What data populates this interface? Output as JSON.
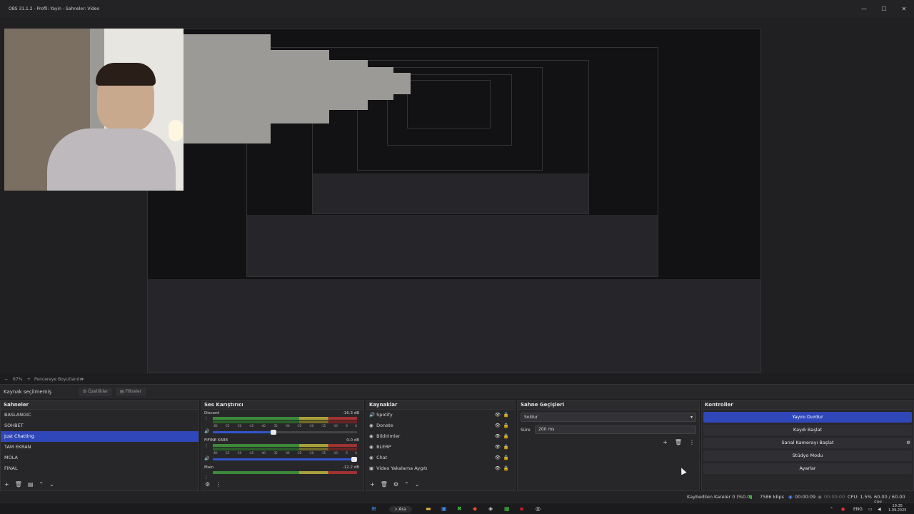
{
  "window": {
    "title": "OBS 31.1.2 - Profil: Yayin - Sahneler: Video",
    "buttons": [
      "—",
      "☐",
      "✕"
    ]
  },
  "preview_strip": {
    "zoom": "67%",
    "fit_label": "Pencereye Boyutlandır"
  },
  "source_bar": {
    "no_source": "Kaynak seçilmemiş",
    "properties": "Özellikler",
    "filters": "Filtreler"
  },
  "scenes": {
    "title": "Sahneler",
    "items": [
      "BASLANGIC",
      "SOHBET",
      "Just Chatting",
      "TAM EKRAN",
      "MOLA",
      "FINAL"
    ],
    "active": "Just Chatting",
    "toolbar": [
      "+",
      "🗑",
      "▤",
      "⌃",
      "⌄"
    ]
  },
  "mixer": {
    "title": "Ses Karıştırıcı",
    "channels": [
      {
        "name": "Discord",
        "db": "-16.3 dB",
        "level": 0.44
      },
      {
        "name": "FIFINE K688",
        "db": "0.0 dB",
        "level": 1.0
      },
      {
        "name": "Main",
        "db": "-12.2 dB",
        "level": 0
      }
    ],
    "ticks": [
      "-60",
      "-55",
      "-50",
      "-45",
      "-40",
      "-35",
      "-30",
      "-25",
      "-20",
      "-15",
      "-10",
      "-5",
      "0"
    ]
  },
  "sources": {
    "title": "Kaynaklar",
    "items": [
      {
        "name": "Spotify",
        "icon": "speaker-icon"
      },
      {
        "name": "Donate",
        "icon": "globe-icon"
      },
      {
        "name": "Bildirimler",
        "icon": "globe-icon"
      },
      {
        "name": "BLERP",
        "icon": "globe-icon"
      },
      {
        "name": "Chat",
        "icon": "globe-icon"
      },
      {
        "name": "Video Yakalama Aygıtı",
        "icon": "camera-icon"
      }
    ]
  },
  "transitions": {
    "title": "Sahne Geçişleri",
    "selected": "Soldur",
    "duration_label": "Süre",
    "duration_value": "200 ms"
  },
  "controls": {
    "title": "Kontroller",
    "buttons": [
      "Yayını Durdur",
      "Kaydı Başlat",
      "Sanal Kamerayı Başlat",
      "Stüdyo Modu",
      "Ayarlar"
    ]
  },
  "status": {
    "dropped": "Kaybedilen Kareler 0 (%0.0)",
    "bitrate": "7586 kbps",
    "stream_time": "00:00:09",
    "rec_time": "00:00:00",
    "cpu": "CPU: 1.5%",
    "fps": "60.00 / 60.00 FPS"
  },
  "taskbar": {
    "search": "Ara",
    "lang": "ENG",
    "time": "19:35",
    "date": "1.09.2025"
  },
  "colors": {
    "accent": "#2f47b8",
    "panel": "#272729",
    "background": "#1e1e20"
  }
}
